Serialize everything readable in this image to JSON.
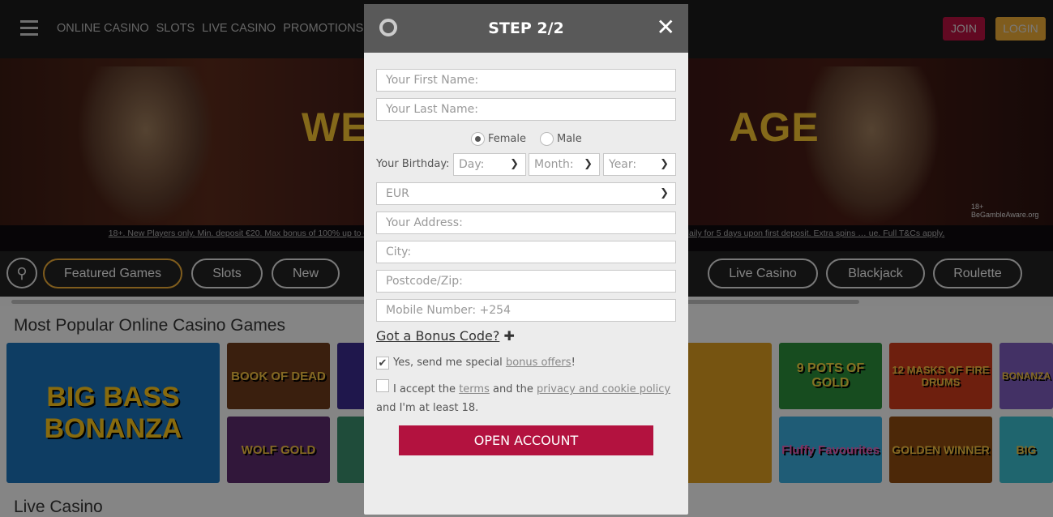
{
  "header": {
    "nav": [
      "ONLINE CASINO",
      "SLOTS",
      "LIVE CASINO",
      "PROMOTIONS"
    ],
    "join": "JOIN",
    "login": "LOGIN"
  },
  "banner": {
    "title": "WE                              AGE",
    "terms": "18+. New Players only. Min. deposit €20. Max bonus of 100% up to €50 on 1st deposit. … ired applies on all bonuses x35. 20 extra spins will be credited daily for 5 days upon first deposit. Extra spins … ue. Full T&Cs apply.",
    "begamble": "BeGambleAware.org",
    "age": "18+"
  },
  "categories": [
    "Featured Games",
    "Slots",
    "New",
    "Live Casino",
    "Blackjack",
    "Roulette"
  ],
  "sections": {
    "popular": "Most Popular Online Casino Games",
    "live": "Live Casino"
  },
  "games": [
    "BIG BASS BONANZA",
    "BOOK OF DEAD",
    "WOLF GOLD",
    "9 POTS OF GOLD",
    "Fluffy Favourites",
    "12 MASKS OF FIRE DRUMS",
    "GOLDEN WINNER",
    "BONANZA",
    "BIG"
  ],
  "modal": {
    "title": "STEP 2/2",
    "first_name": "Your First Name:",
    "last_name": "Your Last Name:",
    "female": "Female",
    "male": "Male",
    "birthday": "Your Birthday:",
    "day": "Day:",
    "month": "Month:",
    "year": "Year:",
    "currency": "EUR",
    "address": "Your Address:",
    "city": "City:",
    "postcode": "Postcode/Zip:",
    "mobile": "Mobile Number: +254",
    "bonus_code": "Got a Bonus Code?",
    "offers_pre": "Yes, send me special ",
    "offers_link": "bonus offers",
    "offers_post": "!",
    "accept_pre": "I accept the ",
    "terms": "terms",
    "and_the": " and the ",
    "privacy": "privacy and cookie policy",
    "accept_post": " and I'm at least 18.",
    "submit": "OPEN ACCOUNT",
    "gender_selected": "Female",
    "offers_checked": true,
    "accept_checked": false
  },
  "colors": {
    "accent": "#b3123f",
    "login": "#e8a835"
  }
}
